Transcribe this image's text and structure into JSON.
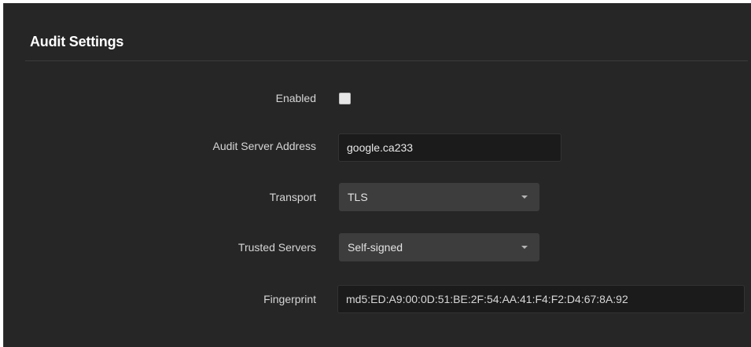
{
  "section": {
    "title": "Audit Settings"
  },
  "form": {
    "enabled": {
      "label": "Enabled",
      "checked": false
    },
    "server_address": {
      "label": "Audit Server Address",
      "value": "google.ca233"
    },
    "transport": {
      "label": "Transport",
      "selected": "TLS"
    },
    "trusted_servers": {
      "label": "Trusted Servers",
      "selected": "Self-signed"
    },
    "fingerprint": {
      "label": "Fingerprint",
      "value": "md5:ED:A9:00:0D:51:BE:2F:54:AA:41:F4:F2:D4:67:8A:92"
    }
  },
  "icons": {
    "dropdown": "caret-down-icon"
  },
  "colors": {
    "panel_background": "#262626",
    "input_background": "#1b1b1b",
    "select_background": "#3d3d3d",
    "checkbox_fill": "#e6e6e6"
  }
}
